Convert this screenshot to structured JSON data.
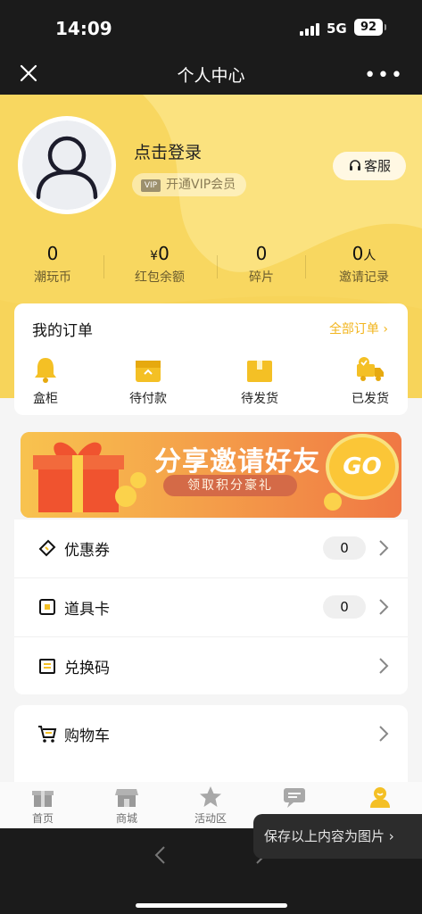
{
  "status_bar": {
    "time": "14:09",
    "network": "5G",
    "battery": "92"
  },
  "nav": {
    "title": "个人中心"
  },
  "profile": {
    "login_text": "点击登录",
    "vip_badge": "VIP",
    "vip_text": "开通VIP会员",
    "service_label": "客服"
  },
  "stats": [
    {
      "value": "0",
      "unit": "",
      "label": "潮玩币"
    },
    {
      "value": "0",
      "prefix": "¥",
      "unit": "",
      "label": "红包余额"
    },
    {
      "value": "0",
      "unit": "",
      "label": "碎片"
    },
    {
      "value": "0",
      "unit": "人",
      "label": "邀请记录"
    }
  ],
  "orders": {
    "title": "我的订单",
    "all_label": "全部订单",
    "items": [
      {
        "label": "盒柜",
        "icon": "bell-icon"
      },
      {
        "label": "待付款",
        "icon": "wallet-box-icon"
      },
      {
        "label": "待发货",
        "icon": "package-box-icon"
      },
      {
        "label": "已发货",
        "icon": "delivery-truck-icon"
      }
    ]
  },
  "banner": {
    "title": "分享邀请好友",
    "subtitle": "领取积分豪礼",
    "cta": "GO"
  },
  "menu": [
    {
      "label": "优惠券",
      "count": "0",
      "icon": "coupon-icon"
    },
    {
      "label": "道具卡",
      "count": "0",
      "icon": "prop-card-icon"
    },
    {
      "label": "兑换码",
      "icon": "redeem-code-icon"
    },
    {
      "label": "购物车",
      "icon": "cart-icon"
    }
  ],
  "tabs": [
    {
      "label": "首页",
      "icon": "gift-home-icon"
    },
    {
      "label": "商城",
      "icon": "store-icon"
    },
    {
      "label": "活动区",
      "icon": "star-icon"
    },
    {
      "label": "",
      "icon": "chat-icon"
    },
    {
      "label": "",
      "icon": "profile-icon"
    }
  ],
  "toast": {
    "text": "保存以上内容为图片"
  },
  "colors": {
    "brand_yellow": "#f8d760",
    "accent_orange": "#f2b51e",
    "dark_bg": "#1b1b1b"
  }
}
